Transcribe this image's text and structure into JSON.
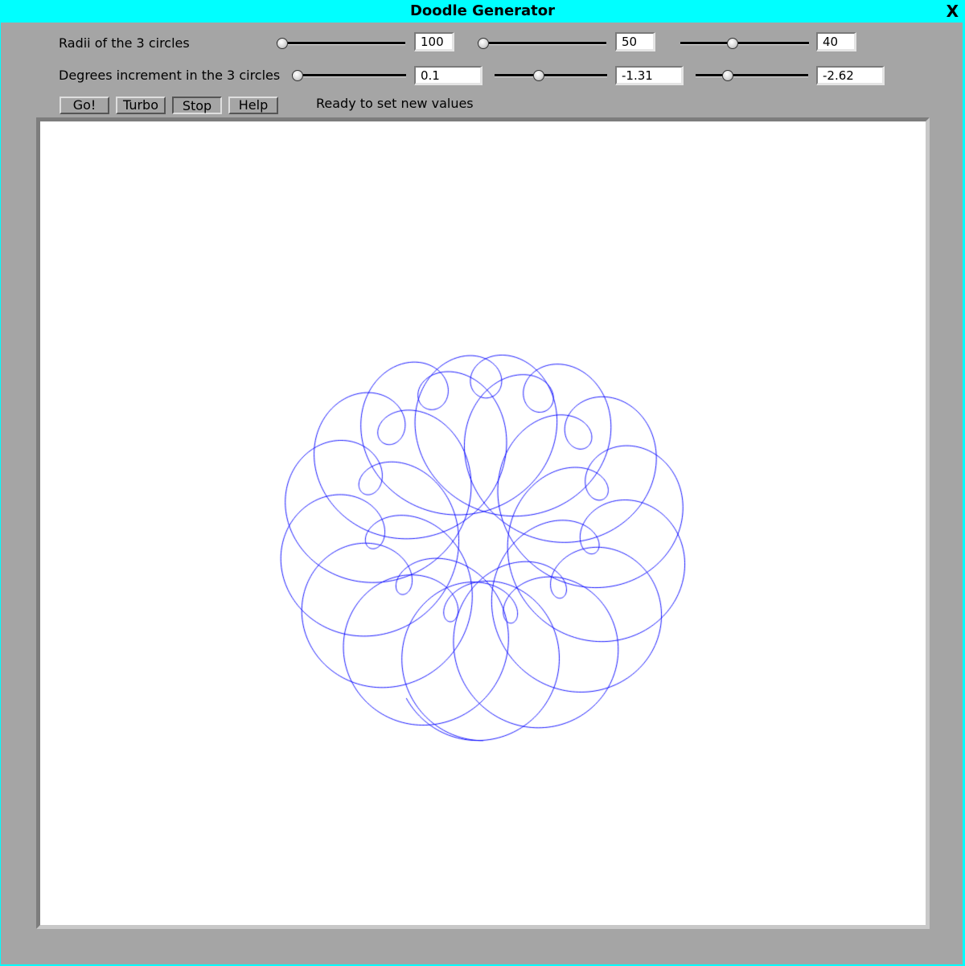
{
  "window": {
    "title": "Doodle Generator",
    "close_label": "X"
  },
  "radii": {
    "label": "Radii of the 3 circles",
    "values": [
      "100",
      "50",
      "40"
    ],
    "slider_levels": [
      0.0,
      0.0,
      0.4
    ]
  },
  "increments": {
    "label": "Degrees increment in the 3 circles",
    "values": [
      "0.1",
      "-1.31",
      "-2.62"
    ],
    "slider_levels": [
      0.0,
      0.38,
      0.26
    ]
  },
  "buttons": {
    "go": "Go!",
    "turbo": "Turbo",
    "stop": "Stop",
    "help": "Help"
  },
  "status": "Ready to set new values",
  "drawing": {
    "color": "#0000ff",
    "background": "#ffffff",
    "radii": [
      100,
      50,
      40
    ],
    "degree_increments": [
      0.1,
      -1.31,
      -2.62
    ]
  }
}
